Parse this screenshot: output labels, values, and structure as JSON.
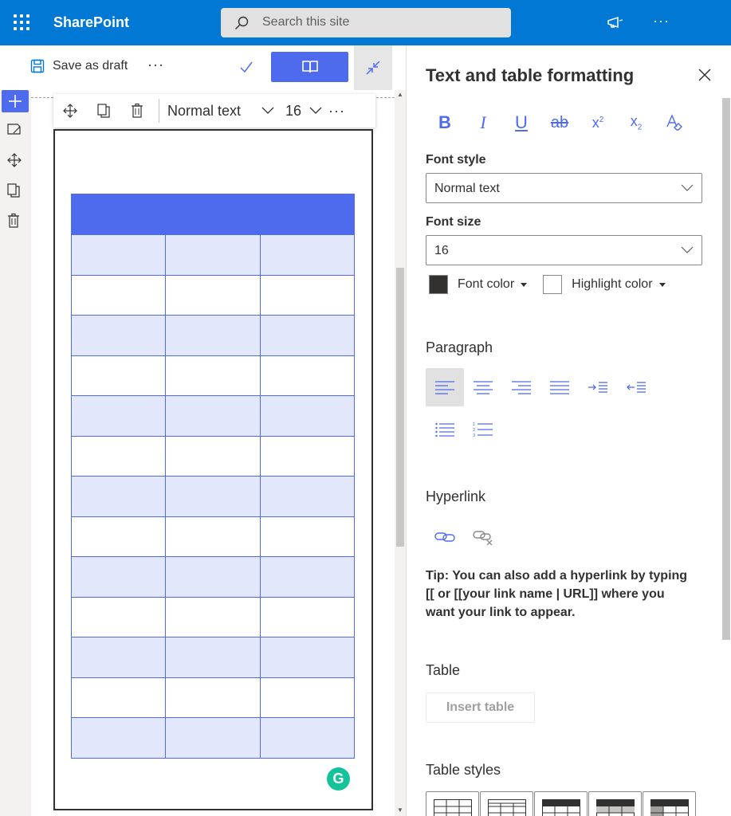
{
  "app": {
    "name": "SharePoint"
  },
  "search": {
    "placeholder": "Search this site"
  },
  "topbar": {
    "more_label": "···"
  },
  "commandbar": {
    "save_label": "Save as draft",
    "more_label": "···"
  },
  "edit_toolbar": {
    "style_value": "Normal text",
    "size_value": "16",
    "more_label": "···"
  },
  "table": {
    "rows": [
      "header",
      "alt",
      "plain",
      "alt",
      "plain",
      "alt",
      "plain",
      "alt",
      "plain",
      "alt",
      "plain",
      "alt",
      "plain",
      "alt"
    ],
    "columns": 3,
    "colors": {
      "header": "#4f6bed",
      "alt": "#e3e7fc",
      "border": "#4f6bed"
    }
  },
  "grammarly": {
    "letter": "G"
  },
  "pane": {
    "title": "Text and table formatting",
    "font_style": {
      "label": "Font style",
      "value": "Normal text"
    },
    "font_size": {
      "label": "Font size",
      "value": "16"
    },
    "font_color": {
      "label": "Font color",
      "color": "#323130"
    },
    "highlight_color": {
      "label": "Highlight color",
      "color": "#ffffff"
    },
    "paragraph": {
      "label": "Paragraph"
    },
    "hyperlink": {
      "label": "Hyperlink",
      "tip": "Tip: You can also add a hyperlink by typing [[ or [[your link name | URL]] where you want your link to appear."
    },
    "table": {
      "label": "Table",
      "insert_label": "Insert table"
    },
    "table_styles": {
      "label": "Table styles"
    }
  },
  "colors": {
    "suite_bar": "#0078d4",
    "accent": "#4f6bed"
  }
}
